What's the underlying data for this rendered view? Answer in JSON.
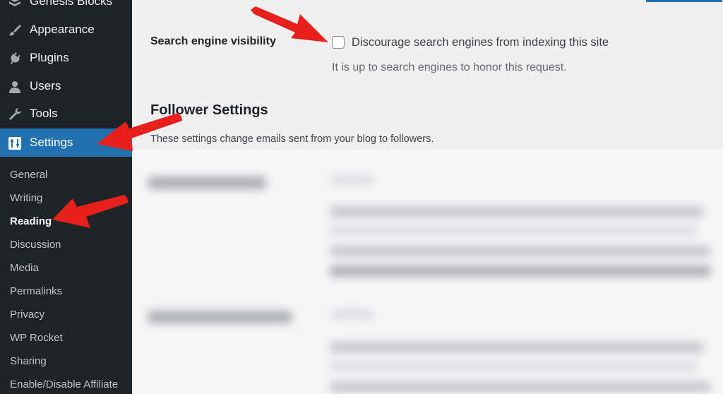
{
  "sidebar": {
    "top_partial": "Genesis Blocks",
    "items": [
      {
        "label": "Appearance",
        "icon": "paintbrush-icon"
      },
      {
        "label": "Plugins",
        "icon": "plug-icon"
      },
      {
        "label": "Users",
        "icon": "user-icon"
      },
      {
        "label": "Tools",
        "icon": "wrench-icon"
      },
      {
        "label": "Settings",
        "icon": "settings-icon",
        "current": true
      }
    ],
    "submenu": [
      {
        "label": "General"
      },
      {
        "label": "Writing"
      },
      {
        "label": "Reading",
        "current": true
      },
      {
        "label": "Discussion"
      },
      {
        "label": "Media"
      },
      {
        "label": "Permalinks"
      },
      {
        "label": "Privacy"
      },
      {
        "label": "WP Rocket"
      },
      {
        "label": "Sharing"
      },
      {
        "label": "Enable/Disable Affiliate"
      }
    ]
  },
  "main": {
    "search_visibility": {
      "label": "Search engine visibility",
      "checkbox_label": "Discourage search engines from indexing this site",
      "checked": false,
      "description": "It is up to search engines to honor this request."
    },
    "follower_settings": {
      "title": "Follower Settings",
      "description": "These settings change emails sent from your blog to followers."
    }
  },
  "colors": {
    "sidebar_bg": "#1d2327",
    "accent": "#2271b1",
    "page_bg": "#f0f0f1",
    "annotation_arrow": "#e8201c"
  }
}
